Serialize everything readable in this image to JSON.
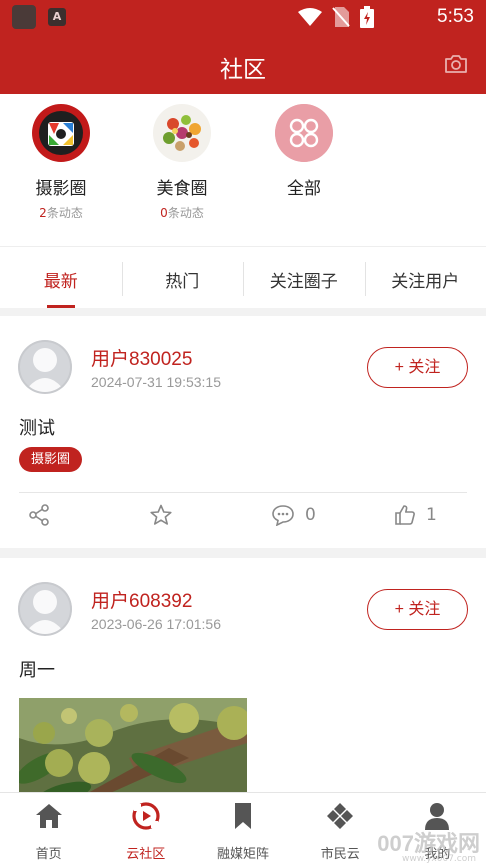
{
  "status_bar": {
    "time": "5:53",
    "app_icon_letter": "A"
  },
  "header": {
    "title": "社区",
    "camera_icon": "camera-icon"
  },
  "circles": [
    {
      "name": "摄影圈",
      "count": "2",
      "suffix": "条动态",
      "icon": "camera-lens-icon"
    },
    {
      "name": "美食圈",
      "count": "0",
      "suffix": "条动态",
      "icon": "food-platter-icon"
    },
    {
      "name": "全部",
      "icon": "four-petal-icon"
    }
  ],
  "tabs": [
    {
      "label": "最新",
      "active": true
    },
    {
      "label": "热门"
    },
    {
      "label": "关注圈子"
    },
    {
      "label": "关注用户"
    }
  ],
  "posts": [
    {
      "user": "用户830025",
      "time": "2024-07-31 19:53:15",
      "follow": "+ 关注",
      "text": "测试",
      "tag": "摄影圈",
      "comments": "0",
      "likes": "1"
    },
    {
      "user": "用户608392",
      "time": "2023-06-26 17:01:56",
      "follow": "+ 关注",
      "text": "周一",
      "image": "jackfruit-tree-photo"
    }
  ],
  "bottom_nav": [
    {
      "label": "首页",
      "icon": "home-icon"
    },
    {
      "label": "云社区",
      "icon": "community-icon",
      "active": true
    },
    {
      "label": "融媒矩阵",
      "icon": "bookmark-icon"
    },
    {
      "label": "市民云",
      "icon": "diamond-grid-icon"
    },
    {
      "label": "我的",
      "icon": "user-icon"
    }
  ],
  "watermark": {
    "text": "007游戏网",
    "sub": "www.yx007.com"
  },
  "colors": {
    "brand": "#c0231f",
    "muted": "#999999"
  }
}
